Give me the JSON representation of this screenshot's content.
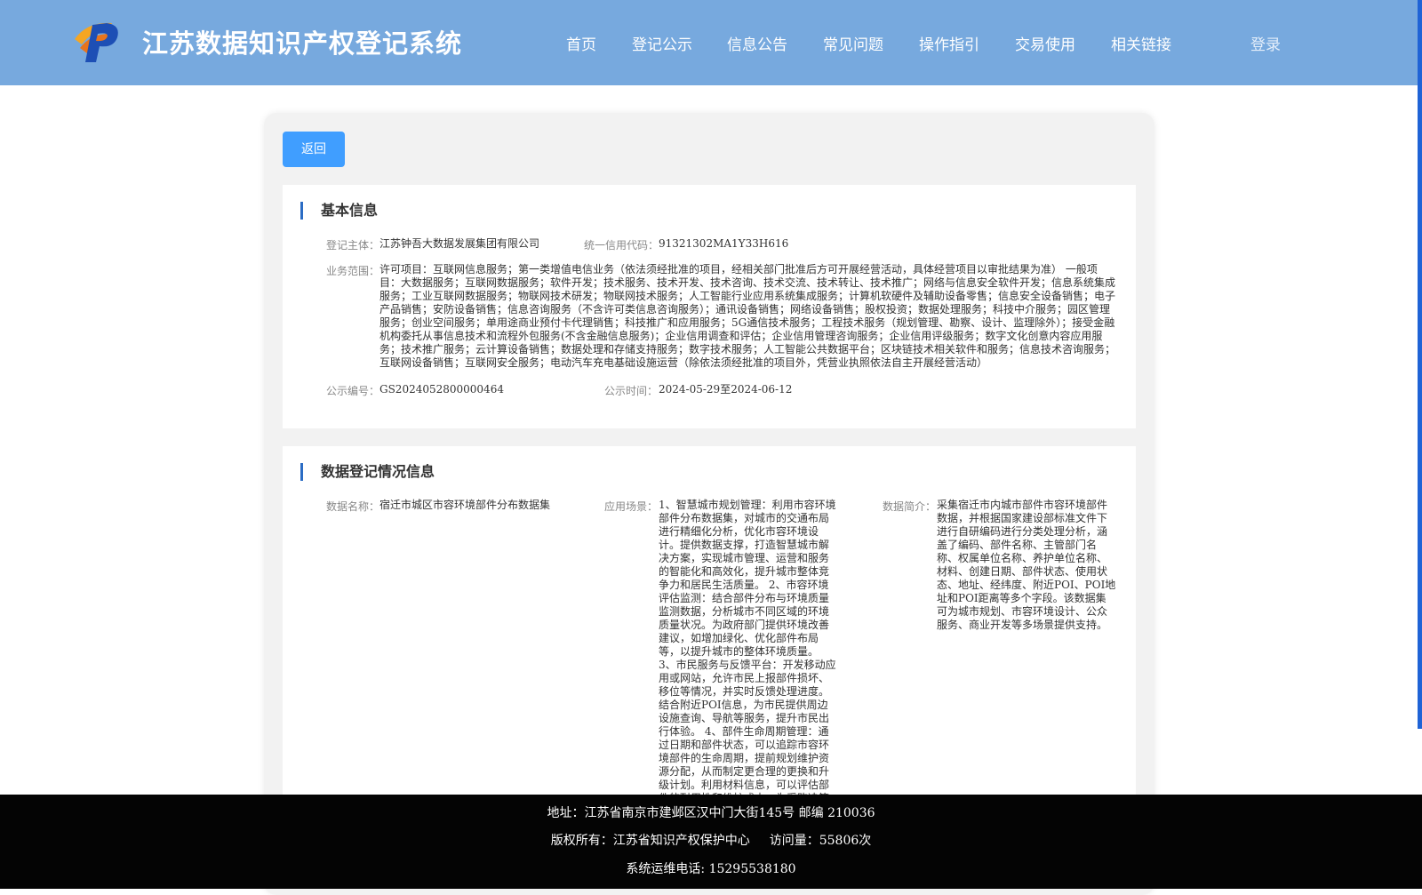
{
  "header": {
    "site_title": "江苏数据知识产权登记系统",
    "nav": [
      "首页",
      "登记公示",
      "信息公告",
      "常见问题",
      "操作指引",
      "交易使用",
      "相关链接"
    ],
    "login": "登录"
  },
  "back_button": "返回",
  "basic_info": {
    "heading": "基本信息",
    "registrant_label": "登记主体：",
    "registrant_value": "江苏钟吾大数据发展集团有限公司",
    "credit_code_label": "统一信用代码：",
    "credit_code_value": "91321302MA1Y33H616",
    "business_scope_label": "业务范围：",
    "business_scope_value": "许可项目：互联网信息服务；第一类增值电信业务（依法须经批准的项目，经相关部门批准后方可开展经营活动，具体经营项目以审批结果为准） 一般项目：大数据服务；互联网数据服务；软件开发；技术服务、技术开发、技术咨询、技术交流、技术转让、技术推广；网络与信息安全软件开发；信息系统集成服务；工业互联网数据服务；物联网技术研发；物联网技术服务；人工智能行业应用系统集成服务；计算机软硬件及辅助设备零售；信息安全设备销售；电子产品销售；安防设备销售；信息咨询服务（不含许可类信息咨询服务）；通讯设备销售；网络设备销售；股权投资；数据处理服务；科技中介服务；园区管理服务；创业空间服务；单用途商业预付卡代理销售；科技推广和应用服务；5G通信技术服务；工程技术服务（规划管理、勘察、设计、监理除外）；接受金融机构委托从事信息技术和流程外包服务(不含金融信息服务)；企业信用调查和评估；企业信用管理咨询服务；企业信用评级服务；数字文化创意内容应用服务；技术推广服务；云计算设备销售；数据处理和存储支持服务；数字技术服务；人工智能公共数据平台；区块链技术相关软件和服务；信息技术咨询服务；互联网设备销售；互联网安全服务；电动汽车充电基础设施运营（除依法须经批准的项目外，凭营业执照依法自主开展经营活动）",
    "notice_no_label": "公示编号：",
    "notice_no_value": "GS2024052800000464",
    "notice_time_label": "公示时间：",
    "notice_time_value": "2024-05-29至2024-06-12"
  },
  "data_info": {
    "heading": "数据登记情况信息",
    "name_label": "数据名称：",
    "name_value": "宿迁市城区市容环境部件分布数据集",
    "scene_label": "应用场景：",
    "scene_value": "1、智慧城市规划管理：利用市容环境部件分布数据集，对城市的交通布局进行精细化分析，优化市容环境设计。提供数据支撑，打造智慧城市解决方案，实现城市管理、运营和服务的智能化和高效化，提升城市整体竞争力和居民生活质量。 2、市容环境评估监测：结合部件分布与环境质量监测数据，分析城市不同区域的环境质量状况。为政府部门提供环境改善建议，如增加绿化、优化部件布局等，以提升城市的整体环境质量。 3、市民服务与反馈平台：开发移动应用或网站，允许市民上报部件损坏、移位等情况，并实时反馈处理进度。结合附近POI信息，为市民提供周边设施查询、导航等服务，提升市民出行体验。 4、部件生命周期管理：通过日期和部件状态，可以追踪市容环境部件的生命周期，提前规划维护资源分配，从而制定更合理的更换和升级计划。利用材料信息，可以评估部件的耐用性和维护成本，为采购决策提供依据。",
    "intro_label": "数据简介：",
    "intro_value": "采集宿迁市内城市部件市容环境部件数据，并根据国家建设部标准文件下进行自研编码进行分类处理分析，涵盖了编码、部件名称、主管部门名称、权属单位名称、养护单位名称、材料、创建日期、部件状态、使用状态、地址、经纬度、附近POI、POI地址和POI距离等多个字段。该数据集可为城市规划、市容环境设计、公众服务、商业开发等多场景提供支持。"
  },
  "footer": {
    "address": "地址：江苏省南京市建邺区汉中门大街145号 邮编 210036",
    "copyright": "版权所有：江苏省知识产权保护中心",
    "visits": "访问量：55806次",
    "phone": "系统运维电话: 15295538180"
  },
  "colors": {
    "header_bg": "#77a9de",
    "accent": "#409eff",
    "section_bar": "#2b6cc4",
    "footer_bg": "#040404"
  }
}
